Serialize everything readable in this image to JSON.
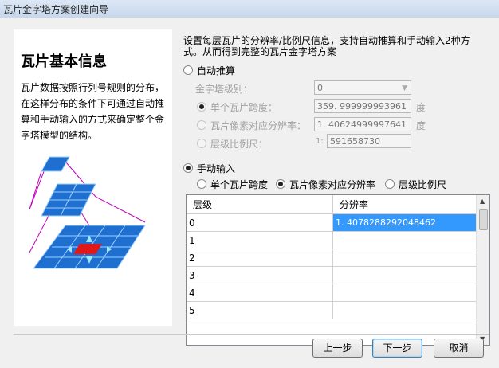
{
  "window": {
    "title": "瓦片金字塔方案创建向导"
  },
  "left_panel": {
    "title": "瓦片基本信息",
    "description": "瓦片数据按照行列号规则的分布，在这样分布的条件下可通过自动推算和手动输入的方式来确定整个金字塔模型的结构。"
  },
  "main": {
    "description": "设置每层瓦片的分辨率/比例尺信息，支持自动推算和手动输入2种方式。从而得到完整的瓦片金字塔方案",
    "auto": {
      "label": "自动推算",
      "selected": false,
      "level_label": "金字塔级别：",
      "level_value": "0",
      "options": [
        {
          "label": "单个瓦片跨度：",
          "value": "359. 999999993961",
          "unit": "度",
          "selected": true
        },
        {
          "label": "瓦片像素对应分辨率：",
          "value": "1. 40624999997641",
          "unit": "度",
          "selected": false
        },
        {
          "label": "层级比例尺：",
          "prefix": "1:",
          "value": "591658730",
          "unit": "",
          "selected": false
        }
      ]
    },
    "manual": {
      "label": "手动输入",
      "selected": true,
      "modes": [
        {
          "label": "单个瓦片跨度",
          "selected": false
        },
        {
          "label": "瓦片像素对应分辨率",
          "selected": true
        },
        {
          "label": "层级比例尺",
          "selected": false
        }
      ],
      "table": {
        "columns": [
          "层级",
          "分辨率"
        ],
        "rows": [
          {
            "level": "0",
            "resolution": "1. 4078288292048462"
          },
          {
            "level": "1",
            "resolution": ""
          },
          {
            "level": "2",
            "resolution": ""
          },
          {
            "level": "3",
            "resolution": ""
          },
          {
            "level": "4",
            "resolution": ""
          },
          {
            "level": "5",
            "resolution": ""
          }
        ]
      }
    }
  },
  "buttons": {
    "prev": "上一步",
    "next": "下一步",
    "cancel": "取消"
  },
  "colors": {
    "accent": "#3399ff",
    "tile_blue": "#1e6fd0",
    "tile_red": "#e01818",
    "pyramid_edge": "#c000c0"
  }
}
